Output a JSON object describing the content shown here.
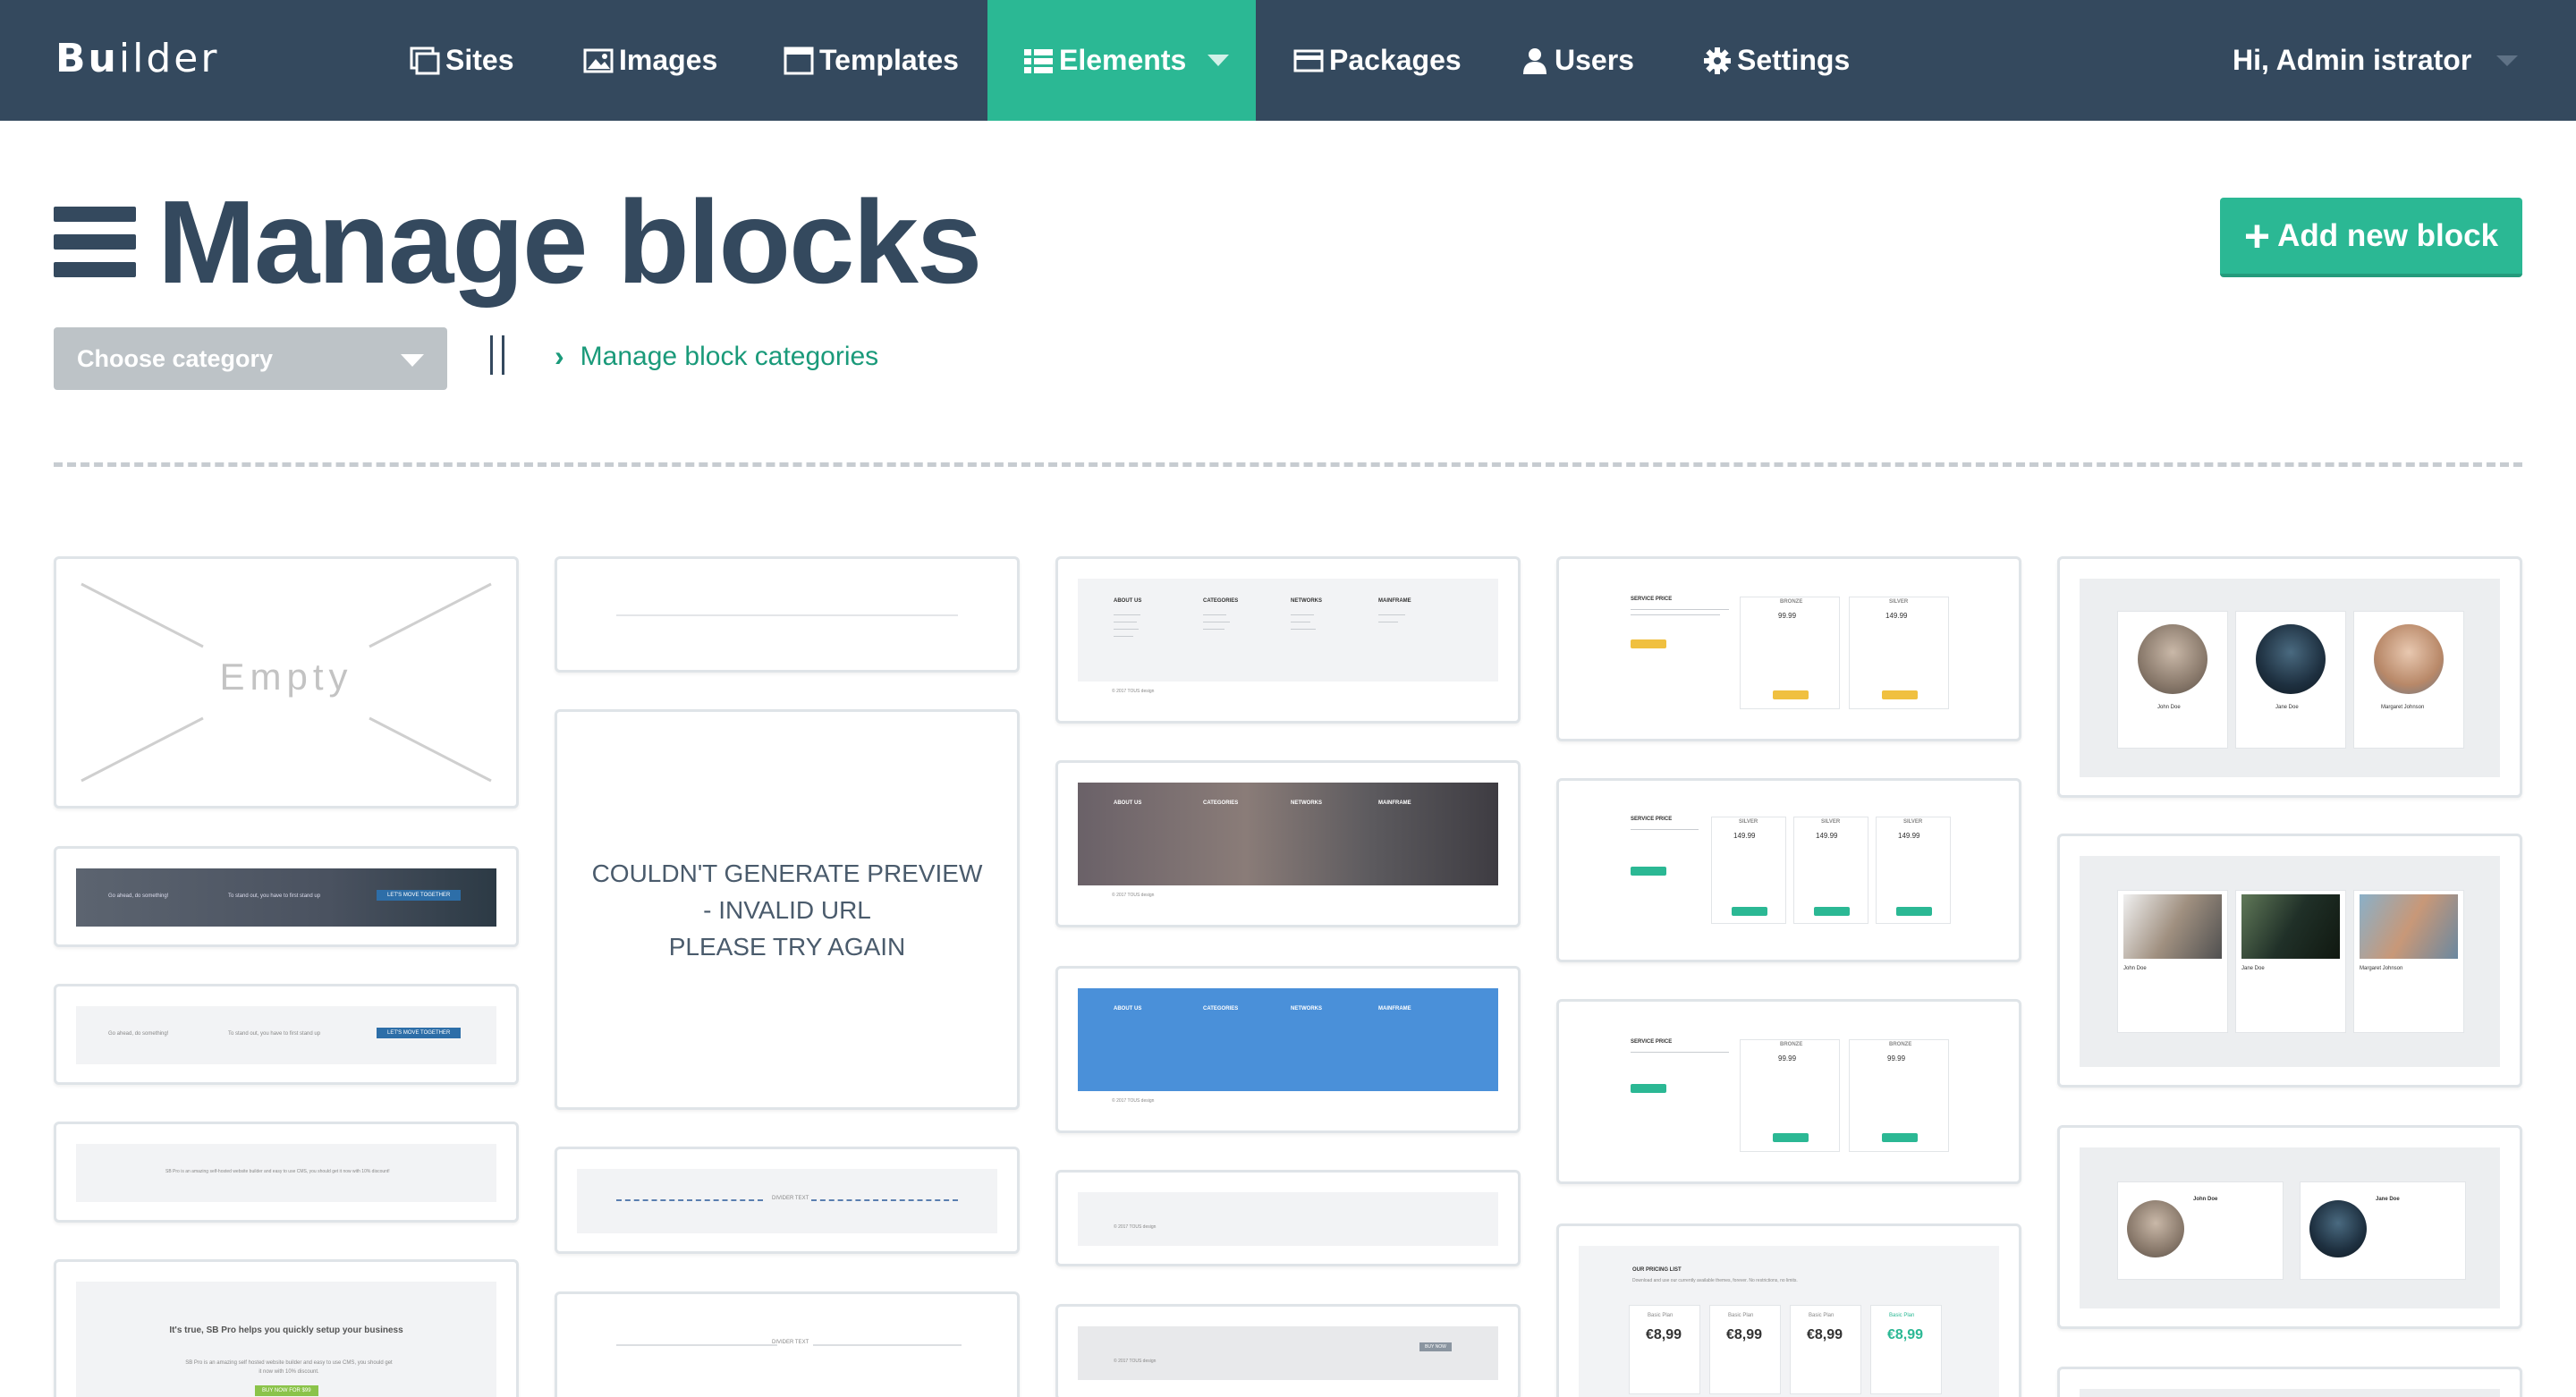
{
  "app": {
    "brand": "Builder"
  },
  "nav": {
    "items": [
      {
        "label": "Sites",
        "icon": "sites-icon"
      },
      {
        "label": "Images",
        "icon": "image-icon"
      },
      {
        "label": "Templates",
        "icon": "templates-icon"
      },
      {
        "label": "Elements",
        "icon": "list-icon",
        "active": true
      },
      {
        "label": "Packages",
        "icon": "card-icon"
      },
      {
        "label": "Users",
        "icon": "user-icon"
      },
      {
        "label": "Settings",
        "icon": "gear-icon"
      }
    ],
    "user_greeting": "Hi, Admin istrator"
  },
  "page": {
    "title": "Manage blocks",
    "add_button": "Add new block",
    "category_select": "Choose category",
    "categories_link": "Manage block categories"
  },
  "blocks": {
    "empty_label": "Empty",
    "error_line1": "COULDN'T GENERATE PREVIEW",
    "error_line2": "- INVALID URL",
    "error_line3": "PLEASE TRY AGAIN",
    "cta_dark": {
      "left": "Go ahead, do something!",
      "middle": "To stand out, you have to first stand up",
      "button": "LET'S MOVE TOGETHER"
    },
    "cta_light": {
      "left": "Go ahead, do something!",
      "middle": "To stand out, you have to first stand up",
      "button": "LET'S MOVE TOGETHER"
    },
    "promo_line": "SB Pro is an amazing self-hosted website builder and easy to use CMS, you should get it now with 10% discount!",
    "promo_title": "It's true, SB Pro helps you quickly setup your business",
    "promo_body": "SB Pro is an amazing self hosted website builder and easy to use CMS, you should get it now with 10% discount.",
    "promo_button": "BUY NOW FOR $99",
    "divider_text": "DIVIDER TEXT",
    "footer_cols": [
      "ABOUT US",
      "CATEGORIES",
      "NETWORKS",
      "MAINFRAME"
    ],
    "footer_copyright": "© 2017 TOUS design",
    "service_price": "SERVICE PRICE",
    "plan_bronze": "BRONZE",
    "plan_silver": "SILVER",
    "price_1": "149.99",
    "price_2": "99.99",
    "buy_now": "BUY NOW",
    "pricing_list_title": "OUR PRICING LIST",
    "pricing_list_sub": "Download and use our currently available themes, forever. No restrictions, no limits.",
    "basic_plan": "Basic Plan",
    "price_euro": "€8,99",
    "team": [
      "John Doe",
      "Jane Doe",
      "Margaret Johnson"
    ]
  },
  "colors": {
    "nav_bg": "#34495e",
    "accent": "#2bb894",
    "select_bg": "#bdc3c7",
    "blue_block": "#4a90d9"
  }
}
